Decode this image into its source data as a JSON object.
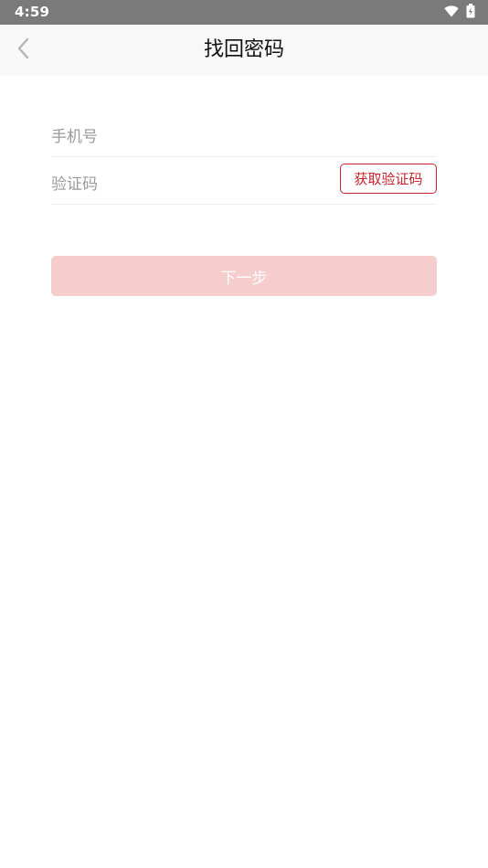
{
  "status_bar": {
    "time": "4:59",
    "icons": [
      "wifi-icon",
      "battery-charging-icon"
    ]
  },
  "header": {
    "title": "找回密码",
    "back_icon": "chevron-left-icon"
  },
  "form": {
    "phone": {
      "placeholder": "手机号",
      "value": ""
    },
    "code": {
      "placeholder": "验证码",
      "value": ""
    },
    "get_code_label": "获取验证码"
  },
  "actions": {
    "next_label": "下一步"
  },
  "colors": {
    "status_bar_bg": "#7a7a7a",
    "app_bar_bg": "#f8f8f8",
    "accent": "#c8232c",
    "next_disabled_bg": "#f5cdcd"
  }
}
